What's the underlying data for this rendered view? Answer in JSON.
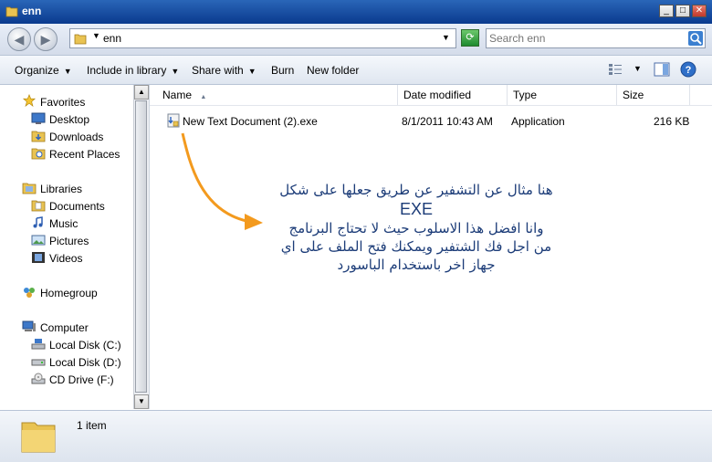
{
  "window": {
    "title": "enn",
    "min_glyph": "_",
    "max_glyph": "□",
    "close_glyph": "✕"
  },
  "address": {
    "path": "enn",
    "search_placeholder": "Search enn"
  },
  "toolbar": {
    "organize": "Organize",
    "include_in_library": "Include in library",
    "share_with": "Share with",
    "burn": "Burn",
    "new_folder": "New folder"
  },
  "nav": {
    "favorites": "Favorites",
    "desktop": "Desktop",
    "downloads": "Downloads",
    "recent_places": "Recent Places",
    "libraries": "Libraries",
    "documents": "Documents",
    "music": "Music",
    "pictures": "Pictures",
    "videos": "Videos",
    "homegroup": "Homegroup",
    "computer": "Computer",
    "local_disk_c": "Local Disk (C:)",
    "local_disk_d": "Local Disk (D:)",
    "cd_drive_f": "CD Drive (F:)"
  },
  "columns": {
    "name": "Name",
    "date_modified": "Date modified",
    "type": "Type",
    "size": "Size"
  },
  "files": [
    {
      "name": "New Text Document (2).exe",
      "date_modified": "8/1/2011 10:43 AM",
      "type": "Application",
      "size": "216 KB"
    }
  ],
  "annotation": {
    "line1": "هنا مثال عن التشفير عن طريق جعلها على شكل",
    "exe": "EXE",
    "line2": "وانا افضل هذا الاسلوب حيث لا تحتاج البرنامج",
    "line3": "من اجل فك الشتفير ويمكنك فتح الملف على اي",
    "line4": "جهاز اخر باستخدام الباسورد",
    "arrow_color": "#f39a1e"
  },
  "details": {
    "item_count": "1 item"
  },
  "colors": {
    "titlebar": "#1f56a8",
    "annotation_text": "#1c3c78",
    "folder": "#e9c352"
  }
}
